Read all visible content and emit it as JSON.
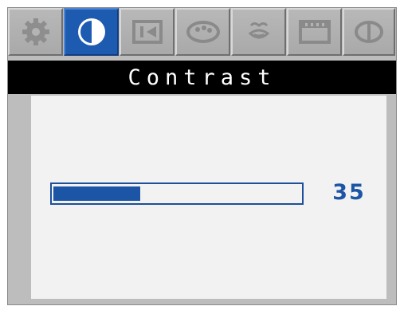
{
  "tabs": [
    {
      "icon": "gear-icon",
      "active": false
    },
    {
      "icon": "contrast-icon",
      "active": true
    },
    {
      "icon": "position-icon",
      "active": false
    },
    {
      "icon": "color-palette-icon",
      "active": false
    },
    {
      "icon": "face-icon",
      "active": false
    },
    {
      "icon": "display-panel-icon",
      "active": false
    },
    {
      "icon": "info-icon",
      "active": false
    }
  ],
  "title": "Contrast",
  "contrast": {
    "value": "35",
    "level_fraction": 0.35
  },
  "colors": {
    "accent": "#1d55a6",
    "tab_inactive": "#b0b0b0",
    "title_bg": "#000000",
    "panel_bg": "#f2f2f2",
    "frame_bg": "#bdbdbd"
  }
}
